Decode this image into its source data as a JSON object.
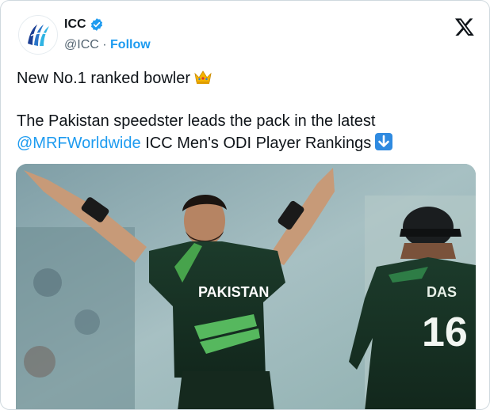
{
  "account": {
    "name": "ICC",
    "handle": "@ICC",
    "separator": "·",
    "follow_label": "Follow",
    "verified": true,
    "avatar_icon": "icc-logo-icon"
  },
  "post": {
    "line1": "New No.1 ranked bowler",
    "line1_emoji": "crown-emoji-icon",
    "line2_start": "The Pakistan speedster leads the pack in the latest",
    "mention": "@MRFWorldwide",
    "line2_end": "ICC Men's ODI Player Rankings",
    "line2_emoji": "down-arrow-emoji-icon"
  },
  "media": {
    "player1_shirt": "PAKISTAN",
    "player2_name": "DAS",
    "player2_number": "16"
  },
  "colors": {
    "accent": "#1d9bf0",
    "text": "#0f1419",
    "secondary": "#536471",
    "jersey_green": "#1f4a35"
  }
}
